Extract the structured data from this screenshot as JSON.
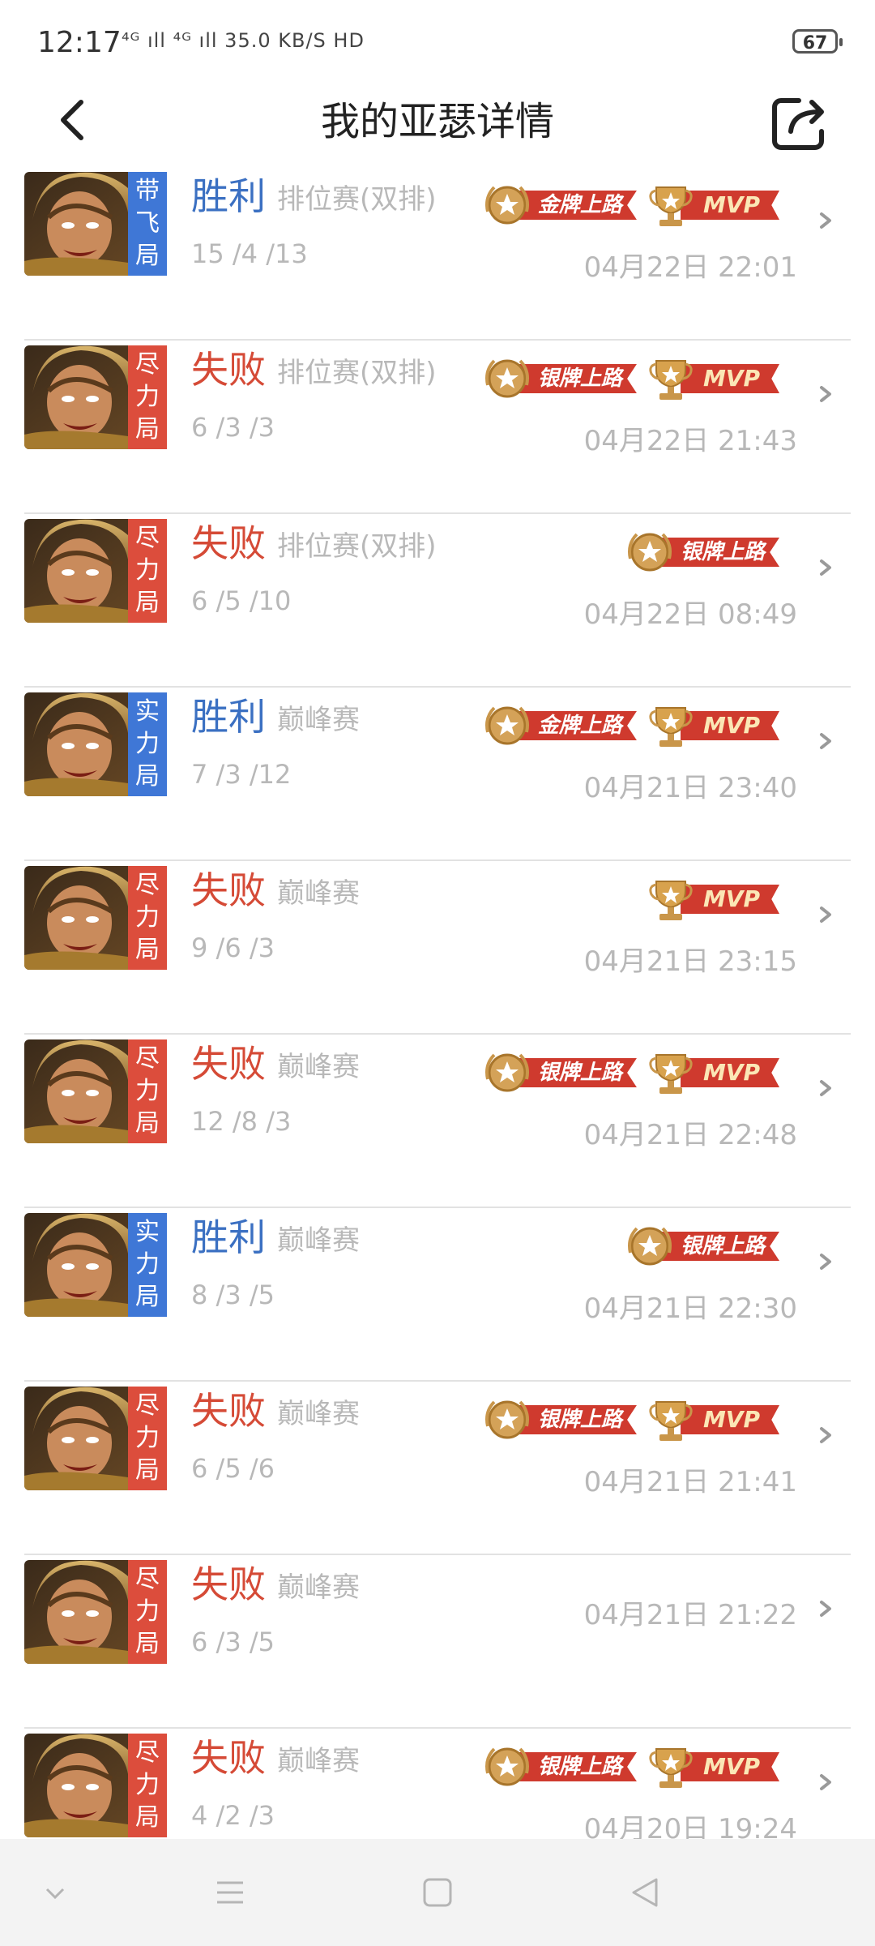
{
  "status_bar": {
    "time": "12:17",
    "network": "⁴ᴳ ıll ⁴ᴳ ıll 35.0 KB/S HD",
    "battery": "67"
  },
  "header": {
    "title": "我的亚瑟详情"
  },
  "colors": {
    "win": "#3b70c2",
    "lose": "#d54a36",
    "tag_blue": "#3f77d6",
    "tag_red": "#dc4d3c",
    "ribbon": "#cf3a2e",
    "medal_gold": "#c9964a"
  },
  "matches": [
    {
      "tag": "带飞局",
      "tag_color": "blue",
      "result": "胜利",
      "outcome": "win",
      "mode": "排位赛(双排)",
      "kda": "15 /4 /13",
      "badges": [
        "金牌上路",
        "MVP"
      ],
      "time": "04月22日 22:01"
    },
    {
      "tag": "尽力局",
      "tag_color": "red",
      "result": "失败",
      "outcome": "lose",
      "mode": "排位赛(双排)",
      "kda": "6 /3 /3",
      "badges": [
        "银牌上路",
        "MVP"
      ],
      "time": "04月22日 21:43"
    },
    {
      "tag": "尽力局",
      "tag_color": "red",
      "result": "失败",
      "outcome": "lose",
      "mode": "排位赛(双排)",
      "kda": "6 /5 /10",
      "badges": [
        "银牌上路"
      ],
      "time": "04月22日 08:49"
    },
    {
      "tag": "实力局",
      "tag_color": "blue",
      "result": "胜利",
      "outcome": "win",
      "mode": "巅峰赛",
      "kda": "7 /3 /12",
      "badges": [
        "金牌上路",
        "MVP"
      ],
      "time": "04月21日 23:40"
    },
    {
      "tag": "尽力局",
      "tag_color": "red",
      "result": "失败",
      "outcome": "lose",
      "mode": "巅峰赛",
      "kda": "9 /6 /3",
      "badges": [
        "MVP"
      ],
      "time": "04月21日 23:15"
    },
    {
      "tag": "尽力局",
      "tag_color": "red",
      "result": "失败",
      "outcome": "lose",
      "mode": "巅峰赛",
      "kda": "12 /8 /3",
      "badges": [
        "银牌上路",
        "MVP"
      ],
      "time": "04月21日 22:48"
    },
    {
      "tag": "实力局",
      "tag_color": "blue",
      "result": "胜利",
      "outcome": "win",
      "mode": "巅峰赛",
      "kda": "8 /3 /5",
      "badges": [
        "银牌上路"
      ],
      "time": "04月21日 22:30"
    },
    {
      "tag": "尽力局",
      "tag_color": "red",
      "result": "失败",
      "outcome": "lose",
      "mode": "巅峰赛",
      "kda": "6 /5 /6",
      "badges": [
        "银牌上路",
        "MVP"
      ],
      "time": "04月21日 21:41"
    },
    {
      "tag": "尽力局",
      "tag_color": "red",
      "result": "失败",
      "outcome": "lose",
      "mode": "巅峰赛",
      "kda": "6 /3 /5",
      "badges": [],
      "time": "04月21日 21:22"
    },
    {
      "tag": "尽力局",
      "tag_color": "red",
      "result": "失败",
      "outcome": "lose",
      "mode": "巅峰赛",
      "kda": "4 /2 /3",
      "badges": [
        "银牌上路",
        "MVP"
      ],
      "time": "04月20日 19:24"
    }
  ],
  "nav_bar": {
    "icons": [
      "chevron-down-icon",
      "menu-icon",
      "home-square-icon",
      "back-triangle-icon"
    ]
  }
}
